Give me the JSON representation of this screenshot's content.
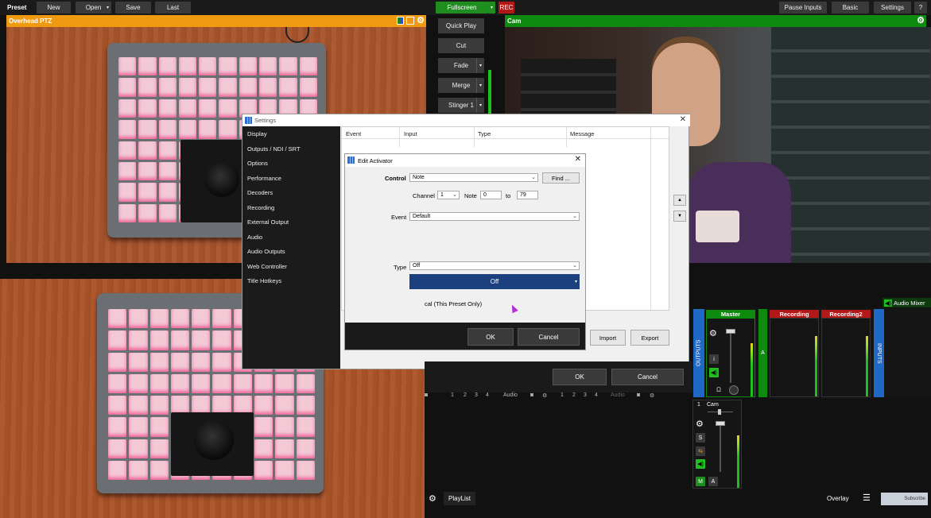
{
  "toolbar": {
    "preset_label": "Preset",
    "new_label": "New",
    "open_label": "Open",
    "save_label": "Save",
    "last_label": "Last",
    "fullscreen_label": "Fullscreen",
    "rec_label": "REC",
    "pause_inputs_label": "Pause Inputs",
    "basic_label": "Basic",
    "settings_label": "Settings",
    "help_label": "?"
  },
  "preview": {
    "title": "Overhead PTZ"
  },
  "output": {
    "title": "Cam"
  },
  "transitions": {
    "quick_play": "Quick Play",
    "cut": "Cut",
    "fade": "Fade",
    "merge": "Merge",
    "stinger": "Stinger 1"
  },
  "settings_dialog": {
    "title": "Settings",
    "sidebar": [
      "Display",
      "Outputs / NDI / SRT",
      "Options",
      "Performance",
      "Decoders",
      "Recording",
      "External Output",
      "Audio",
      "Audio Outputs",
      "Web Controller",
      "Title Hotkeys"
    ],
    "columns": [
      "Event",
      "Input",
      "Type",
      "Message"
    ],
    "import_label": "Import",
    "export_label": "Export",
    "ok_label": "OK",
    "cancel_label": "Cancel"
  },
  "edit_activator": {
    "title": "Edit Activator",
    "control_label": "Control",
    "control_value": "Note",
    "find_label": "Find ...",
    "channel_label": "Channel",
    "channel_value": "1",
    "note_label": "Note",
    "note_from": "0",
    "to_label": "to",
    "note_to": "79",
    "event_label": "Event",
    "event_value": "Default",
    "type_label": "Type",
    "type_value": "Off",
    "dropdown_selected": "Off",
    "local_label": "cal (This Preset Only)",
    "ok_label": "OK",
    "cancel_label": "Cancel"
  },
  "input_bars": {
    "nums_a": [
      "1",
      "2",
      "3",
      "4"
    ],
    "audio_a": "Audio",
    "nums_b": [
      "1",
      "2",
      "3",
      "4"
    ],
    "audio_b": "Audio"
  },
  "mixer": {
    "audio_mixer_label": "Audio Mixer",
    "outputs_label": "OUTPUTS",
    "inputs_label": "INPUTS",
    "master_label": "Master",
    "recording_label": "Recording",
    "recording2_label": "Recording2",
    "a_label": "A",
    "cam_num": "1",
    "cam_label": "Cam",
    "info_label": "i",
    "s_label": "S",
    "m_label": "M",
    "a2_label": "A"
  },
  "bottom_bar": {
    "playlist_label": "PlayList",
    "overlay_label": "Overlay",
    "subscribe_label": "Subscribe"
  },
  "colors": {
    "accent_green": "#1e8f1e",
    "preview_orange": "#f09a12",
    "rec_red": "#b21818",
    "dropdown_blue": "#1c3f7e"
  }
}
